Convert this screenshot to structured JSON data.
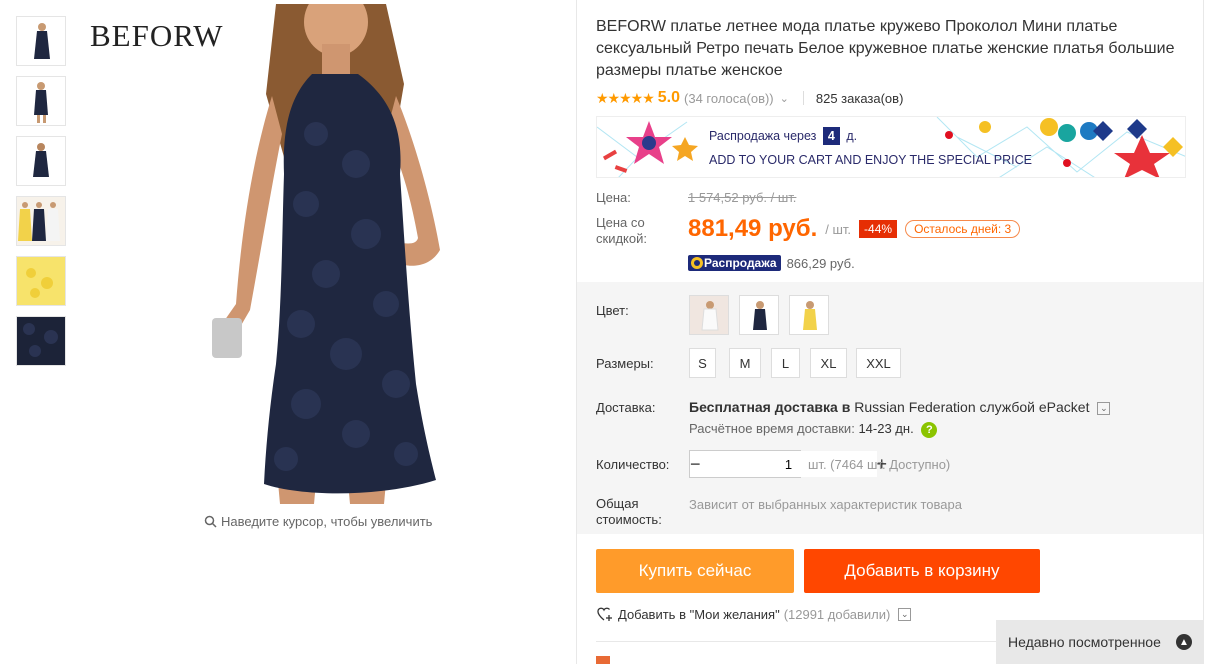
{
  "gallery": {
    "brand": "BEFORW",
    "zoom_hint": "Наведите курсор, чтобы увеличить",
    "thumbnails": [
      "navy-dress-thumb",
      "navy-dress-thumb",
      "navy-dress-thumb",
      "multi-color-dress-thumb",
      "yellow-lace-thumb",
      "navy-lace-closeup-thumb"
    ]
  },
  "product": {
    "title": "BEFORW платье летнее мода платье кружево Проколол Мини платье сексуальный Ретро печать Белое кружевное платье женские платья большие размеры платье женское",
    "stars": "★★★★★",
    "rating": "5.0",
    "votes": "(34 голоса(ов))",
    "orders": "825 заказа(ов)"
  },
  "banner": {
    "text_prefix": "Распродажа через",
    "days": "4",
    "days_suffix": "д.",
    "subtitle": "ADD TO YOUR CART AND ENJOY THE SPECIAL PRICE"
  },
  "pricing": {
    "price_label": "Цена:",
    "old_price": "1 574,52 руб. / шт.",
    "discount_label": "Цена со скидкой:",
    "new_price": "881,49 руб.",
    "per_unit": "/ шт.",
    "discount_percent": "-44%",
    "days_left": "Осталось дней: 3",
    "sale_badge": "Распродажа",
    "sale_price": "866,29 руб."
  },
  "options": {
    "color_label": "Цвет:",
    "size_label": "Размеры:",
    "sizes": [
      "S",
      "M",
      "L",
      "XL",
      "XXL"
    ],
    "shipping_label": "Доставка:",
    "shipping_bold": "Бесплатная доставка в",
    "shipping_country": "Russian Federation",
    "shipping_via": "службой ePacket",
    "delivery_label": "Расчётное время доставки:",
    "delivery_value": "14-23 дн.",
    "quantity_label": "Количество:",
    "quantity_value": "1",
    "quantity_note": "шт. (7464 шт. Доступно)",
    "total_label": "Общая стоимость:",
    "total_note": "Зависит от выбранных характеристик товара"
  },
  "actions": {
    "buy_now": "Купить сейчас",
    "add_to_cart": "Добавить в корзину",
    "wishlist": "Добавить в \"Мои желания\"",
    "wishlist_count": "(12991 добавили)",
    "recently_viewed": "Недавно посмотренное"
  },
  "colors": {
    "accent_orange": "#ff9b2a",
    "cart_red": "#ff4700",
    "price_orange": "#ff6600",
    "sale_navy": "#1d2a7a",
    "dress_navy": "#1f2740"
  }
}
